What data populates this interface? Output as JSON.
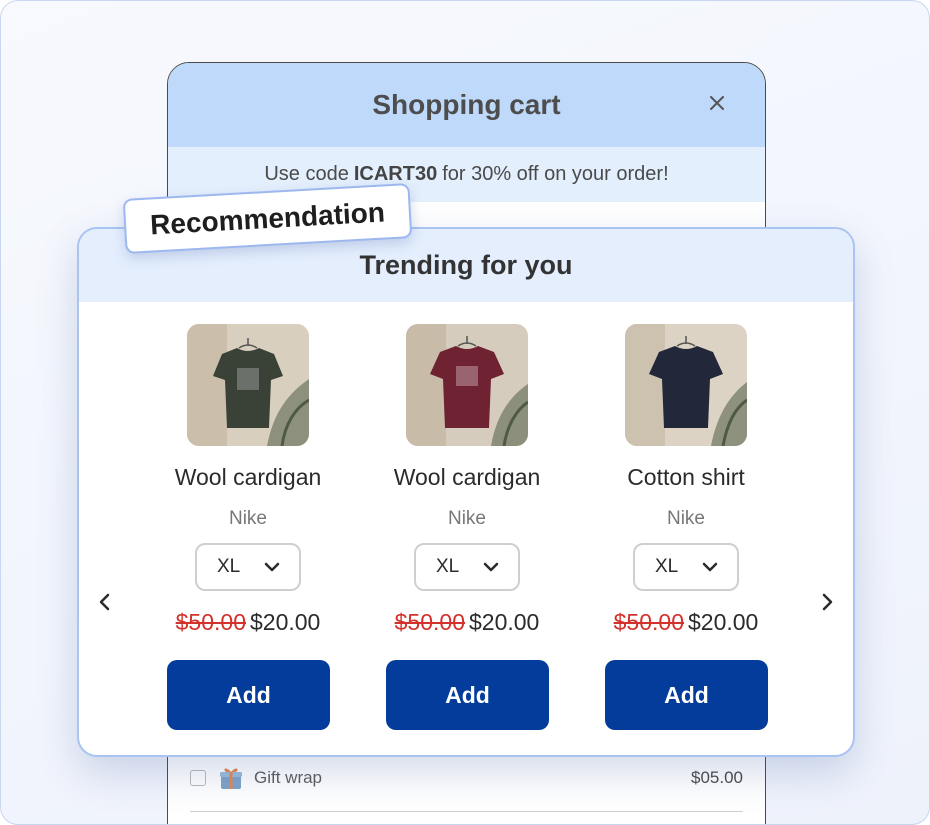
{
  "cart": {
    "title": "Shopping cart",
    "promo": {
      "prefix": "Use code",
      "code": "ICART30",
      "suffix": "for 30% off on your order!"
    },
    "gift_wrap": {
      "label": "Gift wrap",
      "price": "$05.00"
    }
  },
  "tag": {
    "label": "Recommendation"
  },
  "modal": {
    "title": "Trending for you",
    "products": [
      {
        "name": "Wool cardigan",
        "brand": "Nike",
        "size": "XL",
        "old_price": "$50.00",
        "new_price": "$20.00",
        "add_label": "Add",
        "shirt_color": "#3a4238"
      },
      {
        "name": "Wool cardigan",
        "brand": "Nike",
        "size": "XL",
        "old_price": "$50.00",
        "new_price": "$20.00",
        "add_label": "Add",
        "shirt_color": "#6e2232"
      },
      {
        "name": "Cotton shirt",
        "brand": "Nike",
        "size": "XL",
        "old_price": "$50.00",
        "new_price": "$20.00",
        "add_label": "Add",
        "shirt_color": "#22283a"
      }
    ]
  },
  "colors": {
    "cart_header": "#bfd9fb",
    "promo_bar": "#e4effd",
    "modal_header": "#e4eefd",
    "add_button": "#043c9b",
    "old_price": "#d3322c"
  },
  "icons": {
    "close": "close-icon",
    "prev": "chevron-left-icon",
    "next": "chevron-right-icon",
    "dropdown": "chevron-down-icon",
    "gift": "gift-icon"
  }
}
